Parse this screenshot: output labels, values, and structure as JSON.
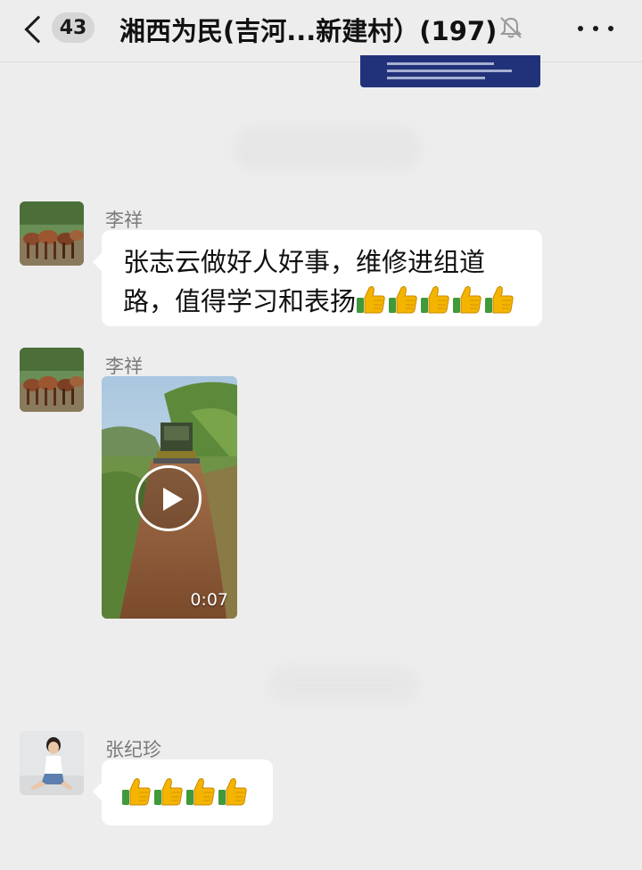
{
  "header": {
    "unread_count": "43",
    "title": "湘西为民(吉河...新建村）(197)",
    "icons": [
      "back-chevron-icon",
      "mute-bell-icon",
      "more-dots-icon"
    ]
  },
  "messages": [
    {
      "sender": "李祥",
      "type": "text",
      "text": "张志云做好人好事，维修进组道路，值得学习和表扬",
      "emoji_count": 5,
      "emoji": "thumbs-up"
    },
    {
      "sender": "李祥",
      "type": "video",
      "duration": "0:07"
    },
    {
      "sender": "张纪珍",
      "type": "emoji",
      "emoji_count": 4,
      "emoji": "thumbs-up"
    }
  ],
  "colors": {
    "background": "#ededed",
    "bubble": "#ffffff",
    "thumbs_yellow": "#f4b400",
    "thumbs_green": "#4caf50"
  }
}
